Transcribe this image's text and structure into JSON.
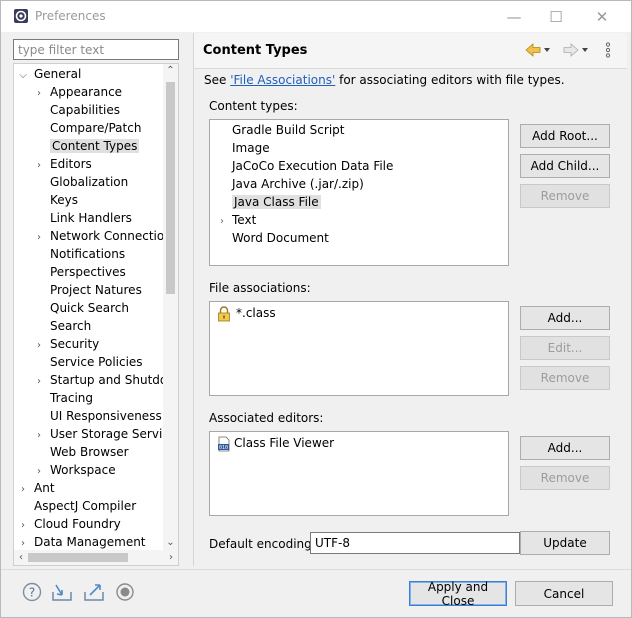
{
  "window": {
    "title": "Preferences",
    "minimize": "—",
    "maximize": "☐",
    "close": "✕"
  },
  "filter": {
    "placeholder": "type filter text",
    "value": ""
  },
  "tree": {
    "items": [
      {
        "label": "General",
        "arrow": "⌵",
        "indent": 0
      },
      {
        "label": "Appearance",
        "arrow": "›",
        "indent": 1
      },
      {
        "label": "Capabilities",
        "arrow": "",
        "indent": 1
      },
      {
        "label": "Compare/Patch",
        "arrow": "",
        "indent": 1
      },
      {
        "label": "Content Types",
        "arrow": "",
        "indent": 1,
        "selected": true
      },
      {
        "label": "Editors",
        "arrow": "›",
        "indent": 1
      },
      {
        "label": "Globalization",
        "arrow": "",
        "indent": 1
      },
      {
        "label": "Keys",
        "arrow": "",
        "indent": 1
      },
      {
        "label": "Link Handlers",
        "arrow": "",
        "indent": 1
      },
      {
        "label": "Network Connection",
        "arrow": "›",
        "indent": 1
      },
      {
        "label": "Notifications",
        "arrow": "",
        "indent": 1
      },
      {
        "label": "Perspectives",
        "arrow": "",
        "indent": 1
      },
      {
        "label": "Project Natures",
        "arrow": "",
        "indent": 1
      },
      {
        "label": "Quick Search",
        "arrow": "",
        "indent": 1
      },
      {
        "label": "Search",
        "arrow": "",
        "indent": 1
      },
      {
        "label": "Security",
        "arrow": "›",
        "indent": 1
      },
      {
        "label": "Service Policies",
        "arrow": "",
        "indent": 1
      },
      {
        "label": "Startup and Shutdow",
        "arrow": "›",
        "indent": 1
      },
      {
        "label": "Tracing",
        "arrow": "",
        "indent": 1
      },
      {
        "label": "UI Responsiveness M",
        "arrow": "",
        "indent": 1
      },
      {
        "label": "User Storage Service",
        "arrow": "›",
        "indent": 1
      },
      {
        "label": "Web Browser",
        "arrow": "",
        "indent": 1
      },
      {
        "label": "Workspace",
        "arrow": "›",
        "indent": 1
      },
      {
        "label": "Ant",
        "arrow": "›",
        "indent": 0
      },
      {
        "label": "AspectJ Compiler",
        "arrow": "",
        "indent": 0
      },
      {
        "label": "Cloud Foundry",
        "arrow": "›",
        "indent": 0
      },
      {
        "label": "Data Management",
        "arrow": "›",
        "indent": 0
      }
    ]
  },
  "page": {
    "title": "Content Types",
    "see_prefix": "See ",
    "see_link": "'File Associations'",
    "see_suffix": " for associating editors with file types.",
    "content_types_label": "Content types:",
    "content_types": [
      {
        "label": "Gradle Build Script",
        "arrow": ""
      },
      {
        "label": "Image",
        "arrow": ""
      },
      {
        "label": "JaCoCo Execution Data File",
        "arrow": ""
      },
      {
        "label": "Java Archive (.jar/.zip)",
        "arrow": ""
      },
      {
        "label": "Java Class File",
        "arrow": "",
        "selected": true
      },
      {
        "label": "Text",
        "arrow": "›"
      },
      {
        "label": "Word Document",
        "arrow": ""
      }
    ],
    "add_root": "Add Root...",
    "add_child": "Add Child...",
    "remove_1": "Remove",
    "file_assoc_label": "File associations:",
    "file_assoc": [
      {
        "label": "*.class"
      }
    ],
    "add_1": "Add...",
    "edit": "Edit...",
    "remove_2": "Remove",
    "assoc_editors_label": "Associated editors:",
    "assoc_editors": [
      {
        "label": "Class File Viewer"
      }
    ],
    "add_2": "Add...",
    "remove_3": "Remove",
    "encoding_label": "Default encoding:",
    "encoding_value": "UTF-8",
    "update": "Update"
  },
  "bottom": {
    "apply_close": "Apply and Close",
    "cancel": "Cancel"
  }
}
